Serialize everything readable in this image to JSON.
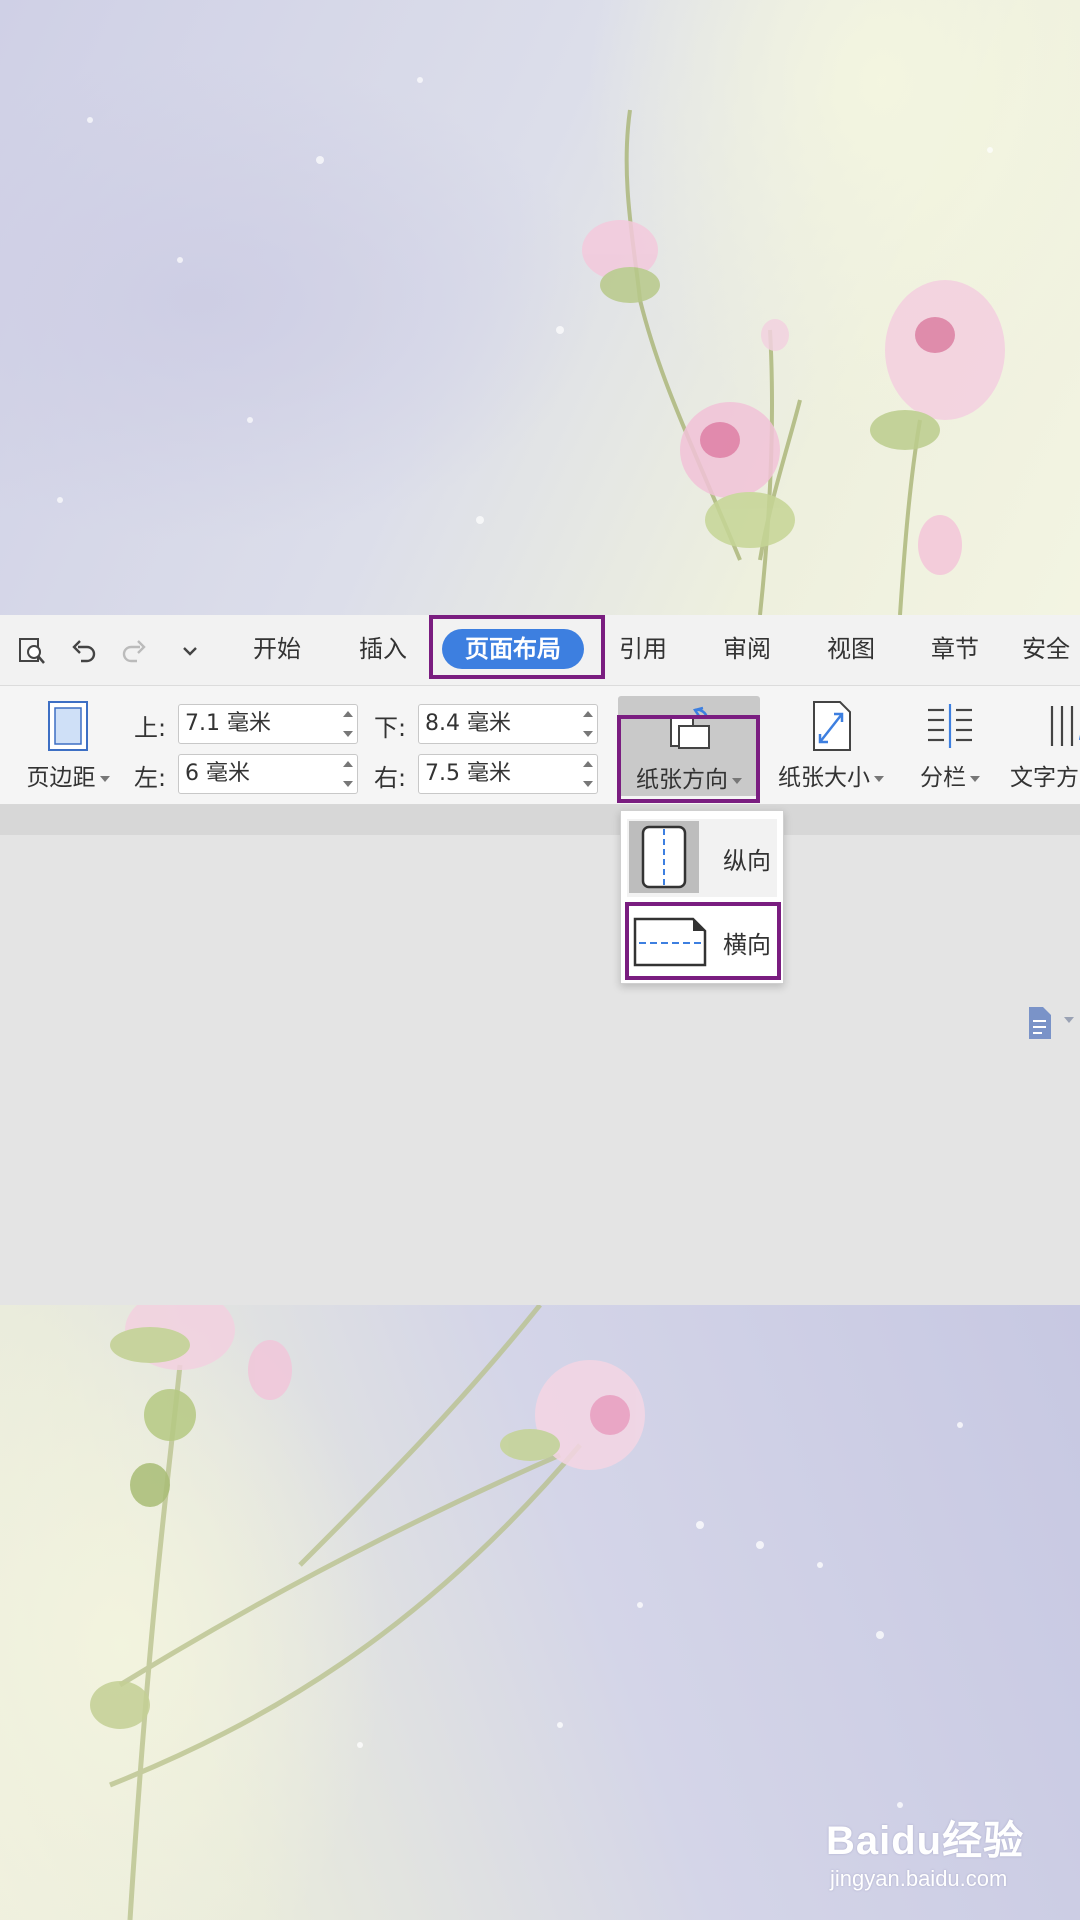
{
  "quick_access": [
    "preview-icon",
    "undo-icon",
    "redo-icon",
    "customize-dropdown-icon"
  ],
  "tabs": [
    {
      "label": "开始"
    },
    {
      "label": "插入"
    },
    {
      "label": "页面布局",
      "active": true
    },
    {
      "label": "引用"
    },
    {
      "label": "审阅"
    },
    {
      "label": "视图"
    },
    {
      "label": "章节"
    },
    {
      "label": "安全"
    }
  ],
  "ribbon": {
    "margins_button": "页边距",
    "top_label": "上:",
    "top_value": "7.1 毫米",
    "bottom_label": "下:",
    "bottom_value": "8.4 毫米",
    "left_label": "左:",
    "left_value": "6 毫米",
    "right_label": "右:",
    "right_value": "7.5 毫米",
    "orientation_button": "纸张方向",
    "size_button": "纸张大小",
    "columns_button": "分栏",
    "text_direction_button": "文字方"
  },
  "orientation_menu": {
    "portrait": "纵向",
    "landscape": "横向"
  },
  "colors": {
    "active_tab": "#3d7fe0",
    "highlight": "#7a1d80"
  },
  "watermark": {
    "brand": "Baidu经验",
    "url": "jingyan.baidu.com"
  }
}
